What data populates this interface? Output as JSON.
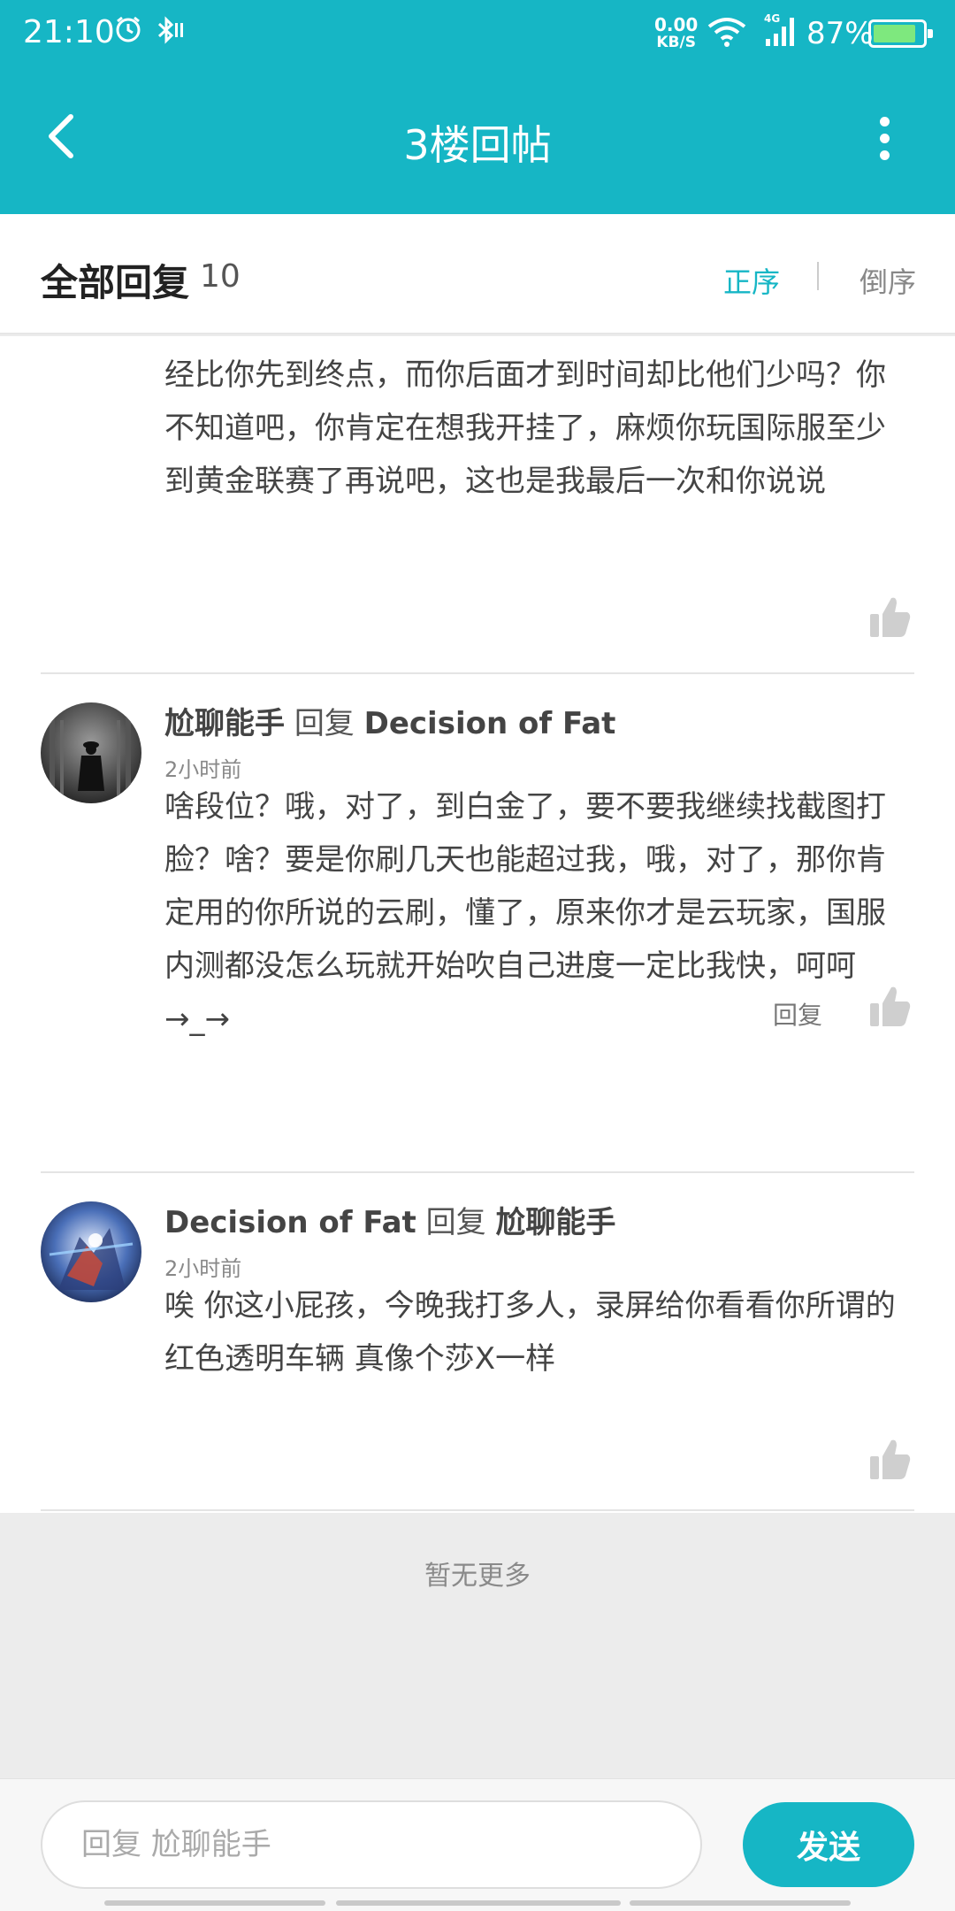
{
  "status_bar": {
    "time": "21:10",
    "net_speed_value": "0.00",
    "net_speed_unit": "KB/S",
    "network_type": "4G",
    "battery_percent": "87%",
    "battery_level": 0.87
  },
  "header": {
    "title": "3楼回帖"
  },
  "sort_bar": {
    "label": "全部回复",
    "count": "10",
    "asc_label": "正序",
    "desc_label": "倒序",
    "active_color": "#16b6c5"
  },
  "comments": [
    {
      "body": "经比你先到终点，而你后面才到时间却比他们少吗？你不知道吧，你肯定在想我开挂了，麻烦你玩国际服至少到黄金联赛了再说吧，这也是我最后一次和你说说"
    },
    {
      "author": "尬聊能手",
      "reply_word": "回复",
      "reply_to": "Decision of Fat",
      "time": "2小时前",
      "body": "啥段位？哦，对了，到白金了，要不要我继续找截图打脸？啥？要是你刷几天也能超过我，哦，对了，那你肯定用的你所说的云刷，懂了，原来你才是云玩家，国服内测都没怎么玩就开始吹自己进度一定比我快，呵呵→_→",
      "reply_label": "回复"
    },
    {
      "author": "Decision of Fat",
      "reply_word": "回复",
      "reply_to": "尬聊能手",
      "time": "2小时前",
      "body": "唉 你这小屁孩，今晚我打多人，录屏给你看看你所谓的红色透明车辆 真像个莎X一样"
    }
  ],
  "footer": {
    "no_more": "暂无更多"
  },
  "bottom_bar": {
    "input_placeholder": "回复 尬聊能手",
    "send_label": "发送"
  }
}
